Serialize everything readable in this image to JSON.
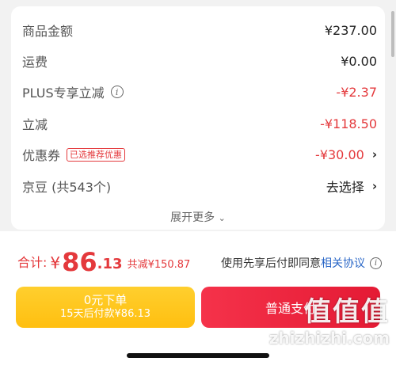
{
  "summary": {
    "rows": [
      {
        "label": "商品金额",
        "value": "¥237.00"
      },
      {
        "label": "运费",
        "value": "¥0.00"
      },
      {
        "label": "PLUS专享立减",
        "value": "-¥2.37"
      },
      {
        "label": "立减",
        "value": "-¥118.50"
      },
      {
        "label": "优惠券",
        "tag": "已选推荐优惠",
        "value": "-¥30.00"
      },
      {
        "label": "京豆 (共543个)",
        "value": "去选择"
      }
    ],
    "expand_label": "展开更多",
    "expand_icon": "chevron-down-icon"
  },
  "footer": {
    "total_label": "合计:",
    "currency": "¥",
    "amount_int": "86",
    "amount_dec": ".13",
    "saved": "共减¥150.87",
    "agree_text": "使用先享后付即同意",
    "agree_link": "相关协议",
    "pay_later_line1": "0元下单",
    "pay_later_line2": "15天后付款¥86.13",
    "pay_now_label": "普通支付"
  },
  "watermark": {
    "logo": "值值值",
    "domain": "zhizhizhi.com"
  },
  "colors": {
    "accent_red": "#e4393c",
    "link_blue": "#2a67c7",
    "pay_later_yellow": "#ffc21a"
  }
}
